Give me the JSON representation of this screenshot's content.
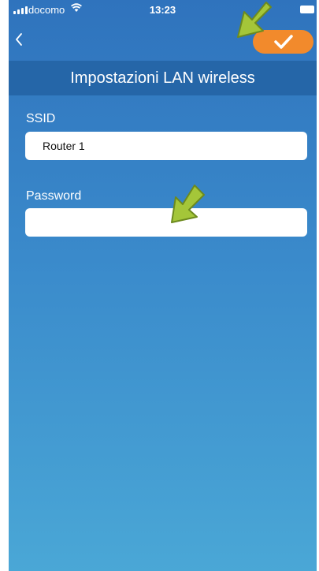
{
  "status_bar": {
    "carrier": "docomo",
    "time": "13:23"
  },
  "header": {
    "title": "Impostazioni LAN wireless"
  },
  "form": {
    "ssid_label": "SSID",
    "ssid_value": "Router 1",
    "password_label": "Password",
    "password_value": ""
  },
  "icons": {
    "back": "chevron-left-icon",
    "confirm": "checkmark-icon",
    "annotation": "arrow-icon"
  },
  "colors": {
    "accent": "#f28a2c",
    "header_bar": "#2566a8",
    "background_top": "#2f73bd",
    "background_bottom": "#4aa7d6",
    "annotation_arrow": "#a4c639"
  }
}
